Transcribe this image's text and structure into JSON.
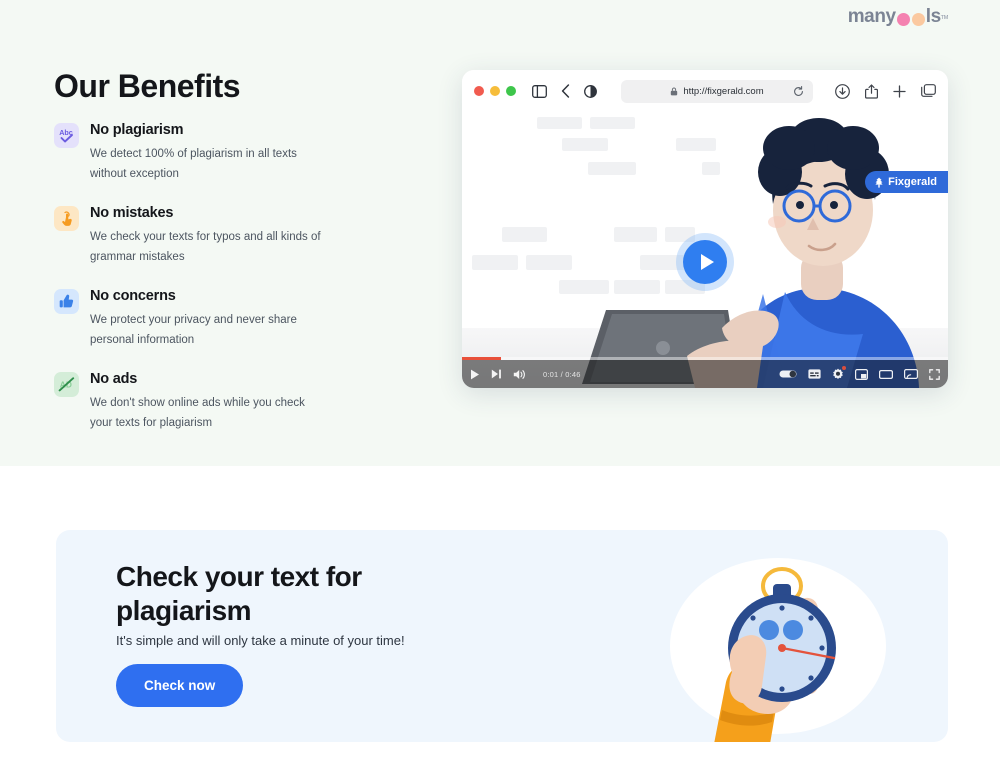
{
  "brand": {
    "name_part1": "many",
    "name_part2": "ls",
    "trademark": "тм",
    "dot1_color": "#f482b0",
    "dot2_color": "#fbc9a0"
  },
  "benefits": {
    "heading": "Our Benefits",
    "items": [
      {
        "icon": "abc-check-icon",
        "icon_bg": "#e4e1fb",
        "icon_fg": "#6b5ce0",
        "title": "No plagiarism",
        "description": "We detect 100% of plagiarism in all texts without exception"
      },
      {
        "icon": "pointing-hand-icon",
        "icon_bg": "#fde7c4",
        "icon_fg": "#f59b20",
        "title": "No mistakes",
        "description": "We check your texts for typos and all kinds of grammar mistakes"
      },
      {
        "icon": "thumbs-up-icon",
        "icon_bg": "#d5e7fd",
        "icon_fg": "#3b82e8",
        "title": "No concerns",
        "description": "We protect your privacy and never share personal information"
      },
      {
        "icon": "no-ads-icon",
        "icon_bg": "#d4edd8",
        "icon_fg": "#3fa35a",
        "title": "No ads",
        "description": "We don't show online ads while you check your texts for plagiarism"
      }
    ]
  },
  "browser": {
    "url": "http://fixgerald.com",
    "traffic_lights": [
      "close",
      "minimize",
      "maximize"
    ],
    "toolbar_icons": [
      "sidebar-icon",
      "back-arrow-icon",
      "reader-contrast-icon"
    ],
    "right_icons": [
      "download-icon",
      "share-icon",
      "new-tab-icon",
      "tab-overview-icon"
    ],
    "badge_label": "Fixgerald",
    "badge_color": "#2f6ad9"
  },
  "video": {
    "play_label": "play",
    "current_time": "0:01",
    "duration": "0:46",
    "time_display": "0:01 / 0:46",
    "controls": [
      "play-icon",
      "next-icon",
      "volume-icon"
    ],
    "right_controls": [
      "autoplay-toggle-icon",
      "subtitles-icon",
      "settings-gear-icon",
      "miniplayer-icon",
      "theater-mode-icon",
      "cast-icon",
      "fullscreen-icon"
    ]
  },
  "cta": {
    "title_line1": "Check your text for",
    "title_line2": "plagiarism",
    "subtitle": "It's simple and will only take a minute of your time!",
    "button_label": "Check now",
    "button_color": "#2f6ff0",
    "card_color": "#eff6fd",
    "illustration": "hand-holding-stopwatch"
  },
  "colors": {
    "top_section_bg": "#f4f9f4",
    "page_bg": "#ffffff",
    "heading": "#14161a",
    "body_text": "#4c5560"
  }
}
